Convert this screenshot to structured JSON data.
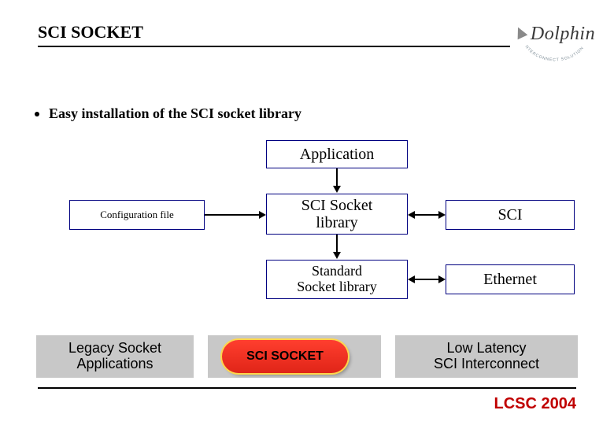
{
  "header": {
    "title": "SCI SOCKET",
    "logo": {
      "brand": "Dolphin",
      "tagline": "INTERCONNECT SOLUTIONS"
    }
  },
  "bullet": "Easy installation of the SCI socket library",
  "boxes": {
    "application": "Application",
    "config": "Configuration file",
    "socket_lib": "SCI Socket\nlibrary",
    "sci": "SCI",
    "std_lib": "Standard\nSocket library",
    "ethernet": "Ethernet"
  },
  "bottom": {
    "legacy": "Legacy Socket\nApplications",
    "pill": "SCI SOCKET",
    "lowlat": "Low Latency\nSCI Interconnect"
  },
  "footer": "LCSC 2004"
}
